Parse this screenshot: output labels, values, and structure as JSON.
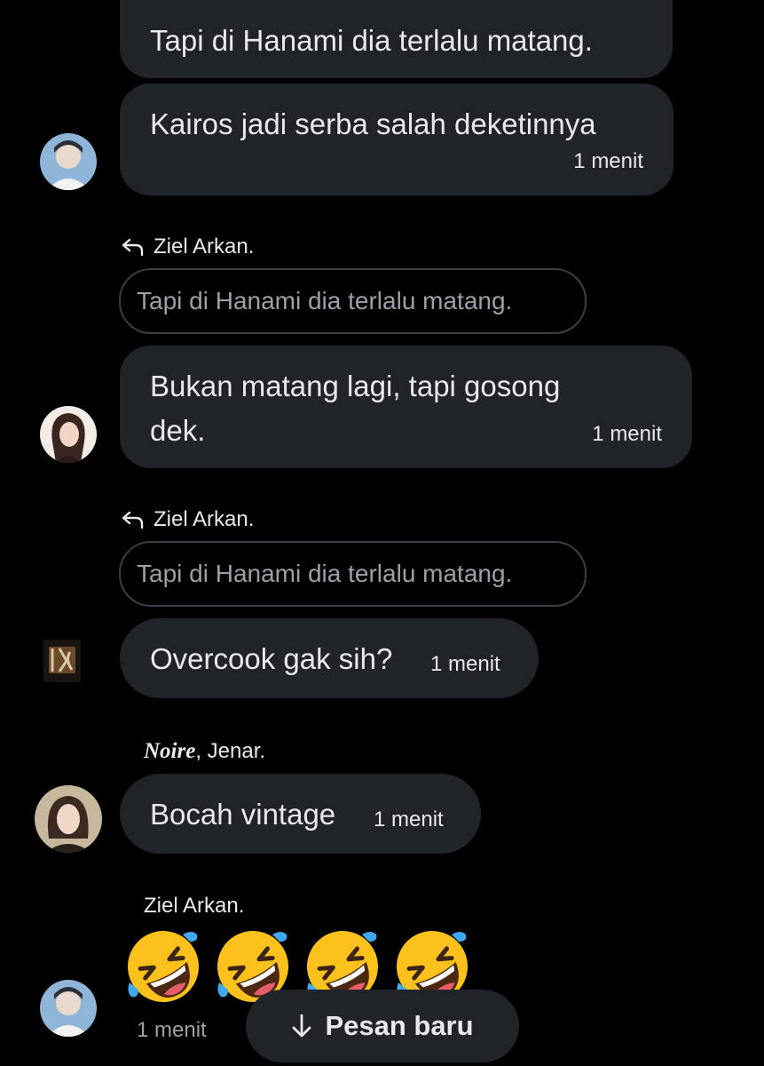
{
  "messages": [
    {
      "text": "Tapi di Hanami dia terlalu matang."
    },
    {
      "text": "Kairos jadi serba salah deketinnya",
      "time": "1 menit"
    },
    {
      "reply_to": "Ziel Arkan.",
      "quote": "Tapi di Hanami dia terlalu matang.",
      "text_line1": "Bukan matang lagi, tapi gosong",
      "text_line2": "dek.",
      "time": "1 menit"
    },
    {
      "reply_to": "Ziel Arkan.",
      "quote": "Tapi di Hanami dia terlalu matang.",
      "text": "Overcook gak sih?",
      "time": "1 menit"
    },
    {
      "sender_italic": "Noire",
      "sender_rest": ", Jenar.",
      "text": "Bocah vintage",
      "time": "1 menit"
    },
    {
      "sender": "Ziel Arkan.",
      "emojis": [
        "rolling-on-floor-laughing",
        "rolling-on-floor-laughing",
        "rolling-on-floor-laughing",
        "rolling-on-floor-laughing"
      ],
      "time": "1 menit"
    }
  ],
  "new_messages_button": {
    "label": "Pesan baru",
    "icon": "arrow-down-icon"
  },
  "colors": {
    "background": "#000000",
    "bubble": "#202327",
    "text": "#e7e9ea",
    "muted": "#9aa1a7",
    "quote_border": "#3b3f44"
  }
}
